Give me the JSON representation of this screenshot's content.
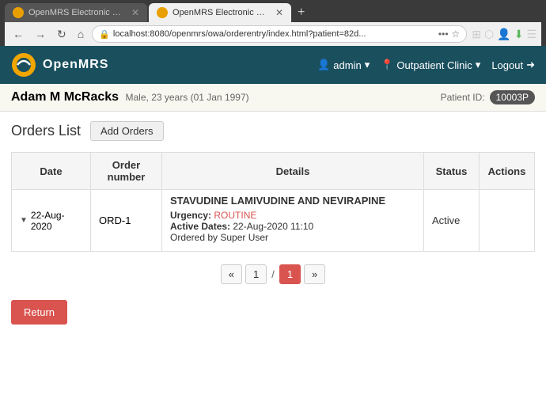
{
  "browser": {
    "tabs": [
      {
        "id": "tab1",
        "title": "OpenMRS Electronic Medical R…",
        "favicon_color": "#e8a000",
        "active": false
      },
      {
        "id": "tab2",
        "title": "OpenMRS Electronic Medical …",
        "favicon_color": "#e8a000",
        "active": true
      }
    ],
    "new_tab_label": "+",
    "address": "localhost:8080/openmrs/owa/orderentry/index.html?patient=82d...",
    "nav": {
      "back": "←",
      "forward": "→",
      "refresh": "↻",
      "home": "⌂"
    }
  },
  "header": {
    "logo_text": "OpenMRS",
    "admin_label": "admin",
    "location_label": "Outpatient Clinic",
    "logout_label": "Logout"
  },
  "patient": {
    "first_name": "Adam",
    "middle_initial": "M",
    "last_name": "McRacks",
    "gender": "Male,",
    "age": "23 years",
    "dob": "(01 Jan 1997)",
    "id_label": "Patient ID:",
    "id_value": "10003P"
  },
  "page": {
    "title": "Orders List",
    "add_orders_btn": "Add Orders"
  },
  "table": {
    "headers": [
      "Date",
      "Order\nnumber",
      "Details",
      "Status",
      "Actions"
    ],
    "rows": [
      {
        "date": "22-Aug-2020",
        "order_number": "ORD-1",
        "drug_name": "STAVUDINE LAMIVUDINE AND NEVIRAPINE",
        "urgency_label": "Urgency:",
        "urgency_value": "ROUTINE",
        "active_dates_label": "Active Dates:",
        "active_dates_value": "22-Aug-2020 11:10",
        "ordered_by": "Ordered by Super User",
        "status": "Active",
        "actions": ""
      }
    ]
  },
  "pagination": {
    "first": "«",
    "prev": "‹",
    "current_page": "1",
    "separator": "/",
    "total_pages": "1",
    "next": "›",
    "last": "»",
    "active_page": "1"
  },
  "footer": {
    "return_btn": "Return"
  }
}
